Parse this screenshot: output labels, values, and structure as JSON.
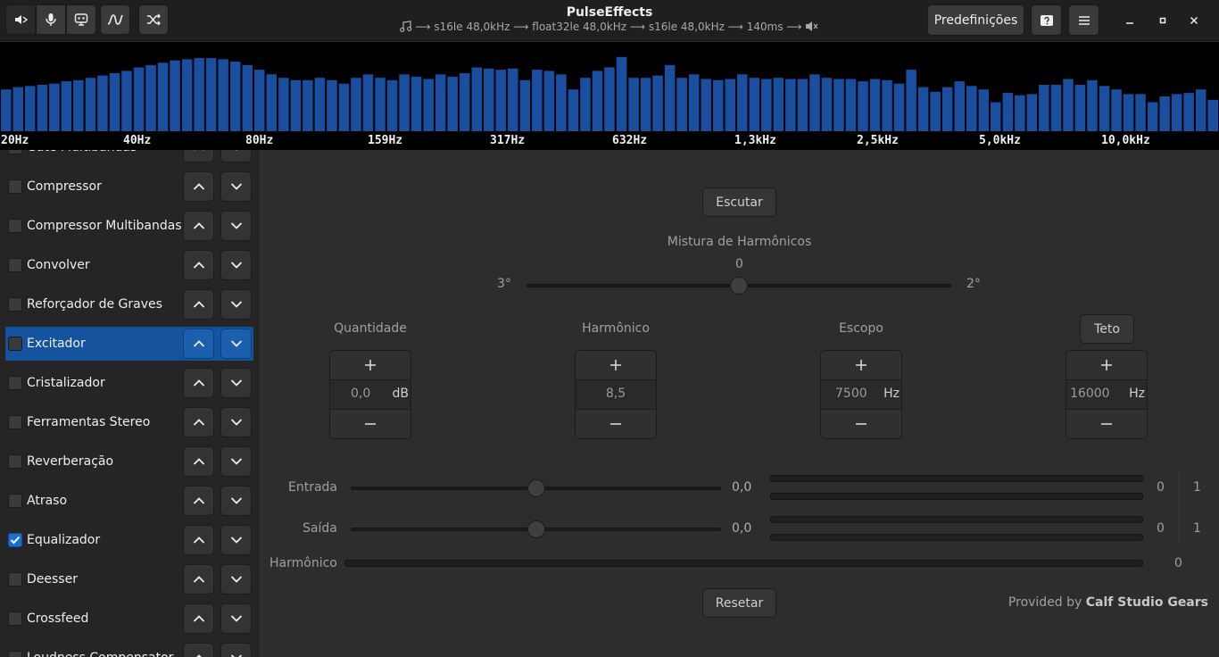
{
  "app": {
    "title": "PulseEffects",
    "pipeline": "⟶ s16le 48,0kHz ⟶ float32le 48,0kHz ⟶ s16le 48,0kHz ⟶ 140ms ⟶",
    "presets_label": "Predefinições"
  },
  "spectrum": {
    "bar_color": "#1a4fa0",
    "freq_labels": [
      "20Hz",
      "40Hz",
      "80Hz",
      "159Hz",
      "317Hz",
      "632Hz",
      "1,3kHz",
      "2,5kHz",
      "5,0kHz",
      "10,0kHz"
    ],
    "levels": [
      0.36,
      0.38,
      0.39,
      0.4,
      0.41,
      0.43,
      0.44,
      0.46,
      0.48,
      0.5,
      0.52,
      0.55,
      0.57,
      0.59,
      0.61,
      0.62,
      0.63,
      0.63,
      0.62,
      0.6,
      0.57,
      0.53,
      0.49,
      0.46,
      0.44,
      0.44,
      0.46,
      0.44,
      0.41,
      0.46,
      0.49,
      0.46,
      0.44,
      0.49,
      0.47,
      0.45,
      0.49,
      0.47,
      0.5,
      0.55,
      0.54,
      0.53,
      0.54,
      0.44,
      0.53,
      0.52,
      0.49,
      0.36,
      0.46,
      0.52,
      0.55,
      0.64,
      0.46,
      0.46,
      0.48,
      0.57,
      0.46,
      0.49,
      0.45,
      0.44,
      0.45,
      0.49,
      0.46,
      0.45,
      0.46,
      0.45,
      0.45,
      0.49,
      0.46,
      0.45,
      0.45,
      0.43,
      0.45,
      0.44,
      0.41,
      0.53,
      0.38,
      0.34,
      0.38,
      0.43,
      0.39,
      0.36,
      0.25,
      0.33,
      0.31,
      0.32,
      0.4,
      0.4,
      0.45,
      0.4,
      0.44,
      0.39,
      0.36,
      0.32,
      0.32,
      0.25,
      0.3,
      0.32,
      0.33,
      0.36,
      0.27
    ]
  },
  "sidebar": {
    "items": [
      {
        "label": "Gate Multibandas",
        "checked": false,
        "selected": false
      },
      {
        "label": "Compressor",
        "checked": false,
        "selected": false
      },
      {
        "label": "Compressor Multibandas",
        "checked": false,
        "selected": false
      },
      {
        "label": "Convolver",
        "checked": false,
        "selected": false
      },
      {
        "label": "Reforçador de Graves",
        "checked": false,
        "selected": false
      },
      {
        "label": "Excitador",
        "checked": false,
        "selected": true
      },
      {
        "label": "Cristalizador",
        "checked": false,
        "selected": false
      },
      {
        "label": "Ferramentas Stereo",
        "checked": false,
        "selected": false
      },
      {
        "label": "Reverberação",
        "checked": false,
        "selected": false
      },
      {
        "label": "Atraso",
        "checked": false,
        "selected": false
      },
      {
        "label": "Equalizador",
        "checked": true,
        "selected": false
      },
      {
        "label": "Deesser",
        "checked": false,
        "selected": false
      },
      {
        "label": "Crossfeed",
        "checked": false,
        "selected": false
      },
      {
        "label": "Loudness Compensator",
        "checked": false,
        "selected": false
      }
    ]
  },
  "main": {
    "listen_label": "Escutar",
    "blend_title": "Mistura de Harmônicos",
    "blend_value": "0",
    "blend_left": "3°",
    "blend_right": "2°",
    "blend_level": 0.5,
    "controls": {
      "amount": {
        "label": "Quantidade",
        "value": "0,0",
        "unit": "dB"
      },
      "harmonics": {
        "label": "Harmônico",
        "value": "8,5",
        "unit": ""
      },
      "scope": {
        "label": "Escopo",
        "value": "7500",
        "unit": "Hz"
      },
      "ceiling": {
        "label": "Teto",
        "value": "16000",
        "unit": "Hz"
      }
    },
    "input": {
      "label": "Entrada",
      "value": "0,0",
      "level_left": "0",
      "level_right": "1",
      "slider_level": 0.5
    },
    "output": {
      "label": "Saída",
      "value": "0,0",
      "level_left": "0",
      "level_right": "1",
      "slider_level": 0.5
    },
    "harmonics_meter": {
      "label": "Harmônico",
      "value": "0"
    },
    "reset_label": "Resetar",
    "credit_prefix": "Provided by",
    "credit_name": "Calf Studio Gears"
  }
}
